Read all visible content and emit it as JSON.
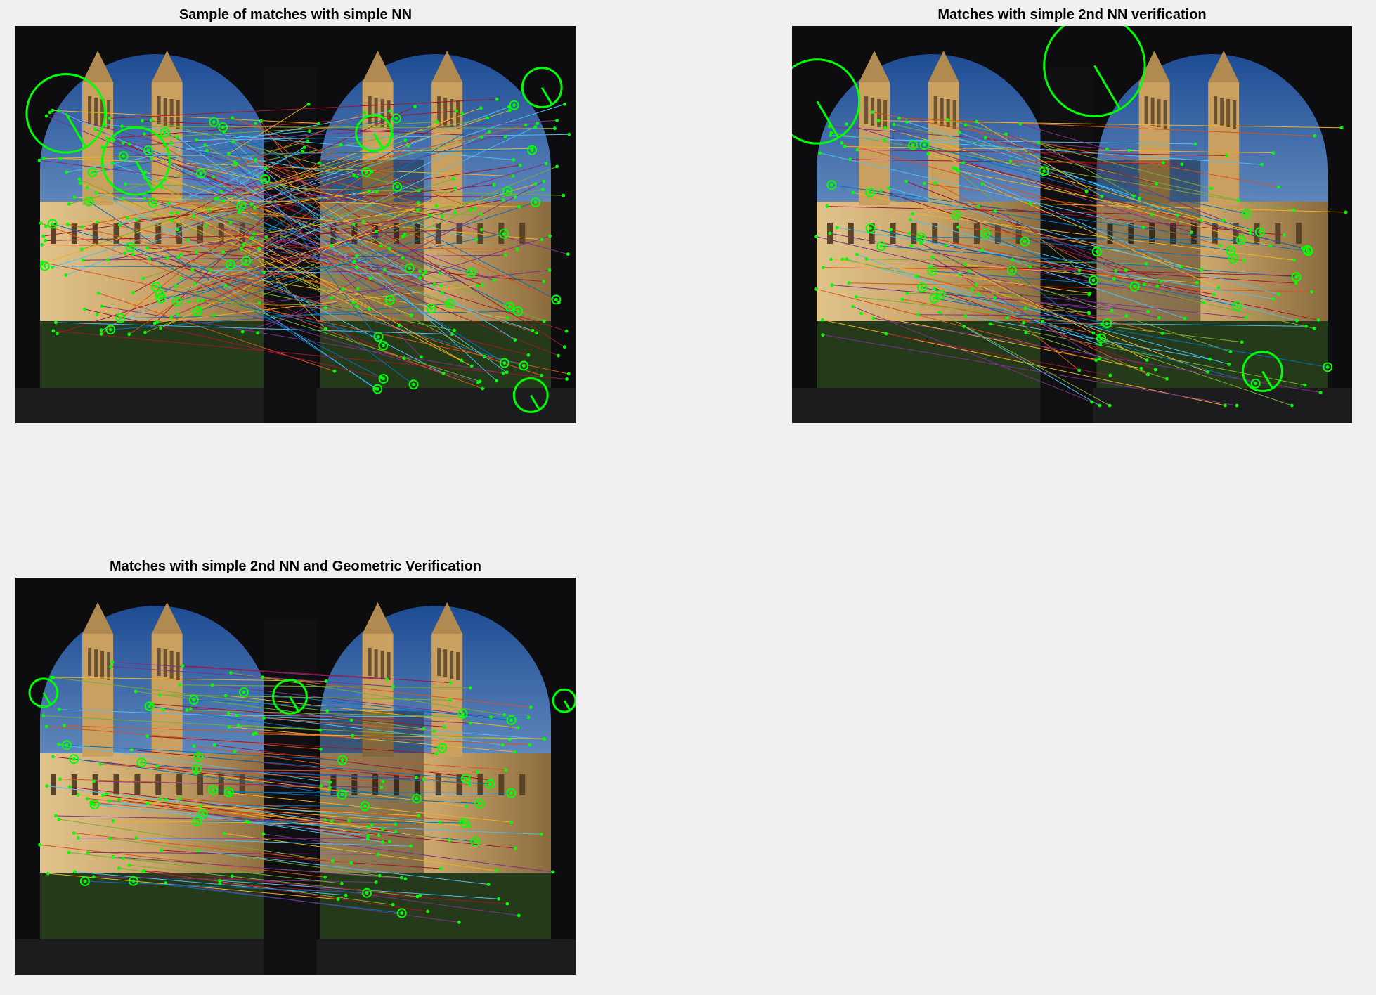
{
  "figure": {
    "background": "#f0f0f0",
    "panels": [
      {
        "id": "panel-nn",
        "title": "Sample of matches with simple NN",
        "match_count": 160,
        "seed": 11,
        "pattern": "random",
        "big_circles": [
          [
            0.09,
            0.22,
            0.07
          ],
          [
            0.215,
            0.34,
            0.06
          ],
          [
            0.94,
            0.155,
            0.035
          ],
          [
            0.92,
            0.93,
            0.03
          ],
          [
            0.64,
            0.27,
            0.032
          ]
        ]
      },
      {
        "id": "panel-2nn",
        "title": "Matches with simple 2nd NN verification",
        "match_count": 110,
        "seed": 23,
        "pattern": "downward",
        "big_circles": [
          [
            0.045,
            0.19,
            0.075
          ],
          [
            0.54,
            0.1,
            0.09
          ],
          [
            0.84,
            0.87,
            0.035
          ]
        ]
      },
      {
        "id": "panel-geo",
        "title": "Matches with simple 2nd NN and Geometric Verification",
        "match_count": 100,
        "seed": 37,
        "pattern": "consistent",
        "big_circles": [
          [
            0.05,
            0.29,
            0.025
          ],
          [
            0.49,
            0.3,
            0.03
          ],
          [
            0.98,
            0.31,
            0.02
          ]
        ]
      }
    ],
    "colors": {
      "keypoint": "#00ff00",
      "match_lines": [
        "#0072bd",
        "#d95319",
        "#edb120",
        "#7e2f8e",
        "#77ac30",
        "#4dbeee",
        "#a2142f"
      ],
      "sky_top": "#1e4c94",
      "sky_light": "#b9d8f2",
      "building": "#c9a46a",
      "grass": "#253a1b",
      "arch_dark": "#0d0d0f"
    }
  }
}
